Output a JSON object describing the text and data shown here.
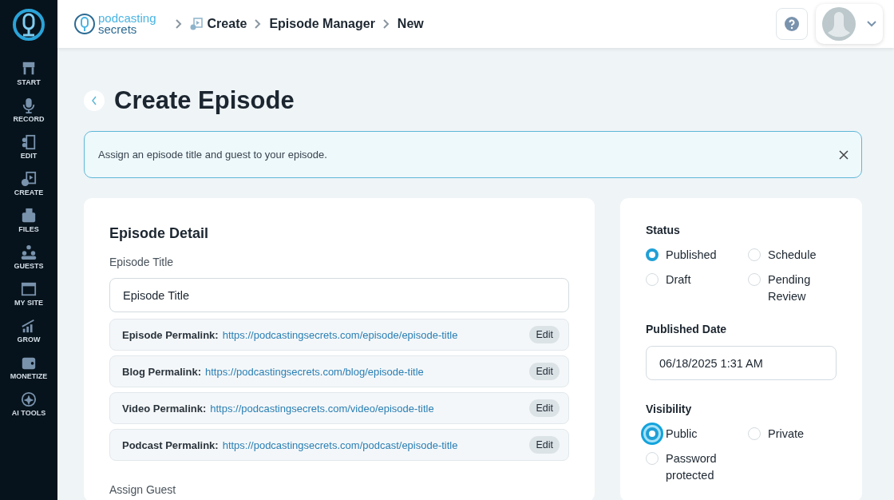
{
  "sidebar": {
    "items": [
      {
        "label": "START"
      },
      {
        "label": "RECORD"
      },
      {
        "label": "EDIT"
      },
      {
        "label": "CREATE"
      },
      {
        "label": "FILES"
      },
      {
        "label": "GUESTS"
      },
      {
        "label": "MY SITE"
      },
      {
        "label": "GROW"
      },
      {
        "label": "MONETIZE"
      },
      {
        "label": "AI TOOLS"
      }
    ]
  },
  "header": {
    "logo_top": "podcasting",
    "logo_bottom": "secrets",
    "breadcrumbs": [
      {
        "label": "Create"
      },
      {
        "label": "Episode Manager"
      },
      {
        "label": "New"
      }
    ]
  },
  "page_title": "Create Episode",
  "notice": {
    "text": "Assign an episode title and guest to your episode."
  },
  "episode_detail": {
    "heading": "Episode Detail",
    "title_label": "Episode Title",
    "title_placeholder": "Episode Title",
    "permalinks": [
      {
        "label": "Episode Permalink:",
        "url": "https://podcastingsecrets.com/episode/episode-title",
        "action": "Edit"
      },
      {
        "label": "Blog Permalink:",
        "url": "https://podcastingsecrets.com/blog/episode-title",
        "action": "Edit"
      },
      {
        "label": "Video Permalink:",
        "url": "https://podcastingsecrets.com/video/episode-title",
        "action": "Edit"
      },
      {
        "label": "Podcast Permalink:",
        "url": "https://podcastingsecrets.com/podcast/episode-title",
        "action": "Edit"
      }
    ],
    "guest_label": "Assign Guest"
  },
  "publish": {
    "status_label": "Status",
    "status_options": [
      {
        "label": "Published",
        "selected": true
      },
      {
        "label": "Schedule",
        "selected": false
      },
      {
        "label": "Draft",
        "selected": false
      },
      {
        "label": "Pending Review",
        "selected": false
      }
    ],
    "date_label": "Published Date",
    "date_value": "06/18/2025 1:31 AM",
    "visibility_label": "Visibility",
    "visibility_options": [
      {
        "label": "Public",
        "selected": true,
        "click_highlight": true
      },
      {
        "label": "Private",
        "selected": false,
        "click_highlight": false
      },
      {
        "label": "Password protected",
        "selected": false,
        "click_highlight": false
      }
    ]
  }
}
